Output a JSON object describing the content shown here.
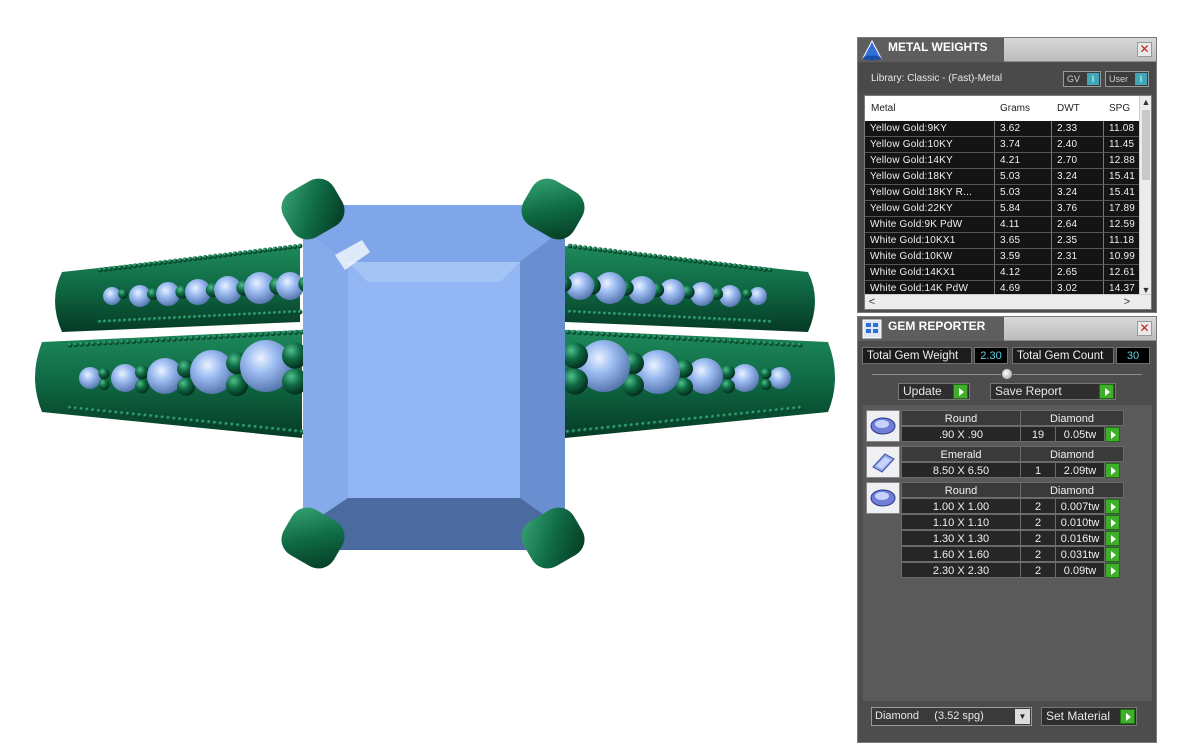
{
  "metal_weights": {
    "title": "METAL WEIGHTS",
    "close_glyph": "✕",
    "library_label": "Library: Classic - (Fast)-Metal",
    "toggles": [
      {
        "label": "GV",
        "indicator": "I"
      },
      {
        "label": "User",
        "indicator": "I"
      }
    ],
    "columns": [
      "Metal",
      "Grams",
      "DWT",
      "SPG"
    ],
    "rows": [
      {
        "metal": "Yellow Gold:9KY",
        "grams": "3.62",
        "dwt": "2.33",
        "spg": "11.08"
      },
      {
        "metal": "Yellow Gold:10KY",
        "grams": "3.74",
        "dwt": "2.40",
        "spg": "11.45"
      },
      {
        "metal": "Yellow Gold:14KY",
        "grams": "4.21",
        "dwt": "2.70",
        "spg": "12.88"
      },
      {
        "metal": "Yellow Gold:18KY",
        "grams": "5.03",
        "dwt": "3.24",
        "spg": "15.41"
      },
      {
        "metal": "Yellow Gold:18KY R...",
        "grams": "5.03",
        "dwt": "3.24",
        "spg": "15.41"
      },
      {
        "metal": "Yellow Gold:22KY",
        "grams": "5.84",
        "dwt": "3.76",
        "spg": "17.89"
      },
      {
        "metal": "White Gold:9K PdW",
        "grams": "4.11",
        "dwt": "2.64",
        "spg": "12.59"
      },
      {
        "metal": "White Gold:10KX1",
        "grams": "3.65",
        "dwt": "2.35",
        "spg": "11.18"
      },
      {
        "metal": "White Gold:10KW",
        "grams": "3.59",
        "dwt": "2.31",
        "spg": "10.99"
      },
      {
        "metal": "White Gold:14KX1",
        "grams": "4.12",
        "dwt": "2.65",
        "spg": "12.61"
      },
      {
        "metal": "White Gold:14K PdW",
        "grams": "4.69",
        "dwt": "3.02",
        "spg": "14.37"
      }
    ],
    "scroll_arrows": {
      "up": "▲",
      "down": "▼",
      "left": "<",
      "right": ">"
    }
  },
  "gem_reporter": {
    "title": "GEM REPORTER",
    "close_glyph": "✕",
    "total_weight_label": "Total Gem Weight",
    "total_weight_value": "2.30",
    "total_count_label": "Total Gem Count",
    "total_count_value": "30",
    "update_label": "Update",
    "save_report_label": "Save Report",
    "groups": [
      {
        "shape": "Round",
        "material": "Diamond",
        "icon": "round-gem-icon",
        "rows": [
          {
            "size": ".90 X .90",
            "count": "19",
            "weight": "0.05tw"
          }
        ]
      },
      {
        "shape": "Emerald",
        "material": "Diamond",
        "icon": "emerald-gem-icon",
        "rows": [
          {
            "size": "8.50 X 6.50",
            "count": "1",
            "weight": "2.09tw"
          }
        ]
      },
      {
        "shape": "Round",
        "material": "Diamond",
        "icon": "round-gem-icon",
        "rows": [
          {
            "size": "1.00 X 1.00",
            "count": "2",
            "weight": "0.007tw"
          },
          {
            "size": "1.10 X 1.10",
            "count": "2",
            "weight": "0.010tw"
          },
          {
            "size": "1.30 X 1.30",
            "count": "2",
            "weight": "0.016tw"
          },
          {
            "size": "1.60 X 1.60",
            "count": "2",
            "weight": "0.031tw"
          },
          {
            "size": "2.30 X 2.30",
            "count": "2",
            "weight": "0.09tw"
          }
        ]
      }
    ],
    "material_select": "Diamond     (3.52 spg)",
    "set_material_label": "Set Material"
  },
  "colors": {
    "metal_green": "#0f6b45",
    "stone_blue": "#8fb4f0",
    "panel_bg": "#4d4d4d",
    "go_green": "#3fae2a"
  }
}
